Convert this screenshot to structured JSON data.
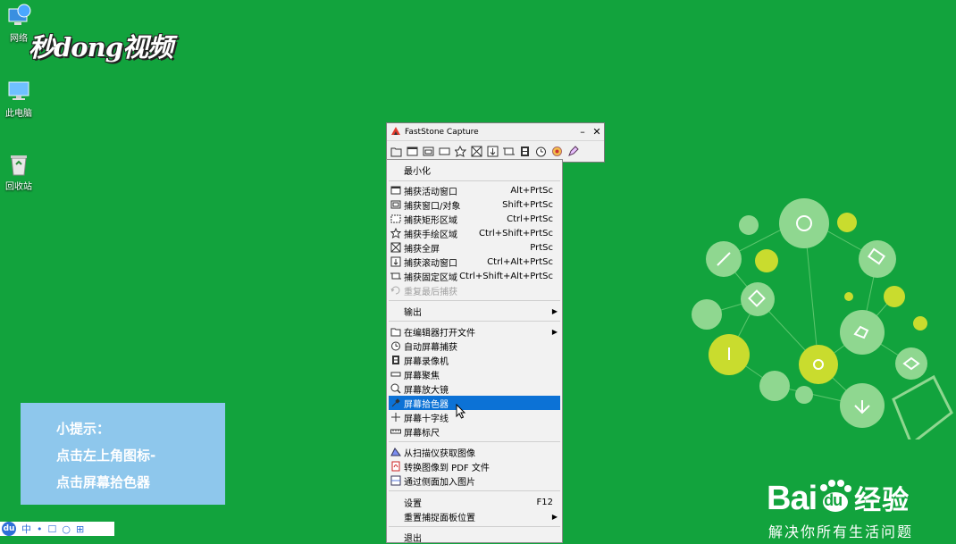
{
  "desktop": {
    "icons": [
      {
        "label": "网络",
        "icon": "network-icon"
      },
      {
        "label": "此电脑",
        "icon": "computer-icon"
      },
      {
        "label": "回收站",
        "icon": "recycle-bin-icon"
      }
    ]
  },
  "watermark": {
    "text": "秒dong视频"
  },
  "tip": {
    "line1": "小提示：",
    "line2": "点击左上角图标-",
    "line3": "点击屏幕拾色器"
  },
  "taskbar": {
    "items": [
      "du",
      "中",
      "•",
      "☐",
      "○",
      "⊞"
    ]
  },
  "window": {
    "title": "FastStone Capture",
    "minimize": "–",
    "close": "✕",
    "toolbar_icons": [
      "open-icon",
      "capture-window-icon",
      "capture-object-icon",
      "capture-rect-icon",
      "capture-freehand-icon",
      "capture-fullscreen-icon",
      "capture-scroll-icon",
      "capture-fixed-icon",
      "recorder-icon",
      "timer-icon",
      "settings-icon",
      "edit-icon"
    ]
  },
  "menu": {
    "minimize": "最小化",
    "items": [
      {
        "label": "捕获活动窗口",
        "shortcut": "Alt+PrtSc"
      },
      {
        "label": "捕获窗口/对象",
        "shortcut": "Shift+PrtSc"
      },
      {
        "label": "捕获矩形区域",
        "shortcut": "Ctrl+PrtSc"
      },
      {
        "label": "捕获手绘区域",
        "shortcut": "Ctrl+Shift+PrtSc"
      },
      {
        "label": "捕获全屏",
        "shortcut": "PrtSc"
      },
      {
        "label": "捕获滚动窗口",
        "shortcut": "Ctrl+Alt+PrtSc"
      },
      {
        "label": "捕获固定区域",
        "shortcut": "Ctrl+Shift+Alt+PrtSc"
      },
      {
        "label": "重复最后捕获",
        "shortcut": ""
      }
    ],
    "output": "输出",
    "tools": [
      "在编辑器打开文件",
      "自动屏幕捕获",
      "屏幕录像机",
      "屏幕聚焦",
      "屏幕放大镜",
      "屏幕拾色器",
      "屏幕十字线",
      "屏幕标尺"
    ],
    "import": [
      "从扫描仪获取图像",
      "转换图像到 PDF 文件",
      "通过侧面加入图片"
    ],
    "settings": "设置",
    "settings_shortcut": "F12",
    "reset_panel": "重置捕捉面板位置",
    "exit": "退出"
  },
  "baidu": {
    "logo_bai": "Bai",
    "logo_du": "du",
    "logo_jingyan": "经验",
    "slogan": "解决你所有生活问题"
  }
}
